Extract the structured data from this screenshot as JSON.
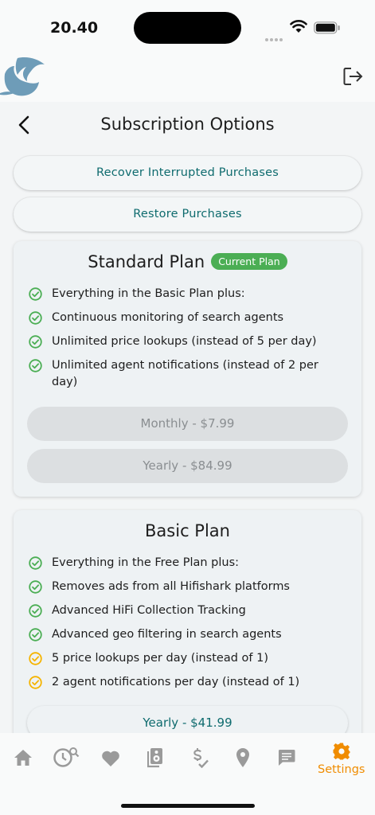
{
  "status": {
    "time": "20.40"
  },
  "header": {
    "title": "Subscription Options"
  },
  "actions": {
    "recover_label": "Recover Interrupted Purchases",
    "restore_label": "Restore Purchases"
  },
  "standard_plan": {
    "name": "Standard Plan",
    "badge": "Current Plan",
    "features": [
      {
        "text": "Everything in the Basic Plan plus:",
        "status": "included"
      },
      {
        "text": "Continuous monitoring of search agents",
        "status": "included"
      },
      {
        "text": "Unlimited price lookups (instead of 5 per day)",
        "status": "included"
      },
      {
        "text": "Unlimited agent notifications (instead of 2 per day)",
        "status": "included"
      }
    ],
    "monthly_label": "Monthly - $7.99",
    "yearly_label": "Yearly - $84.99"
  },
  "basic_plan": {
    "name": "Basic Plan",
    "features": [
      {
        "text": "Everything in the Free Plan plus:",
        "status": "included"
      },
      {
        "text": "Removes ads from all Hifishark platforms",
        "status": "included"
      },
      {
        "text": "Advanced HiFi Collection Tracking",
        "status": "included"
      },
      {
        "text": "Advanced geo filtering in search agents",
        "status": "included"
      },
      {
        "text": "5 price lookups per day (instead of 1)",
        "status": "limited"
      },
      {
        "text": "2 agent notifications per day (instead of 1)",
        "status": "limited"
      }
    ],
    "yearly_label": "Yearly - $41.99"
  },
  "nav": {
    "items": [
      "home-icon",
      "history-search-icon",
      "heart-icon",
      "speaker-icon",
      "price-check-icon",
      "location-pin-icon",
      "message-icon",
      "gear-icon"
    ],
    "active_label": "Settings"
  },
  "colors": {
    "accent": "#0e6b6e",
    "included": "#4bae54",
    "limited": "#f5b400",
    "active_nav": "#f08c00",
    "inactive_nav": "#9a9a9a"
  }
}
